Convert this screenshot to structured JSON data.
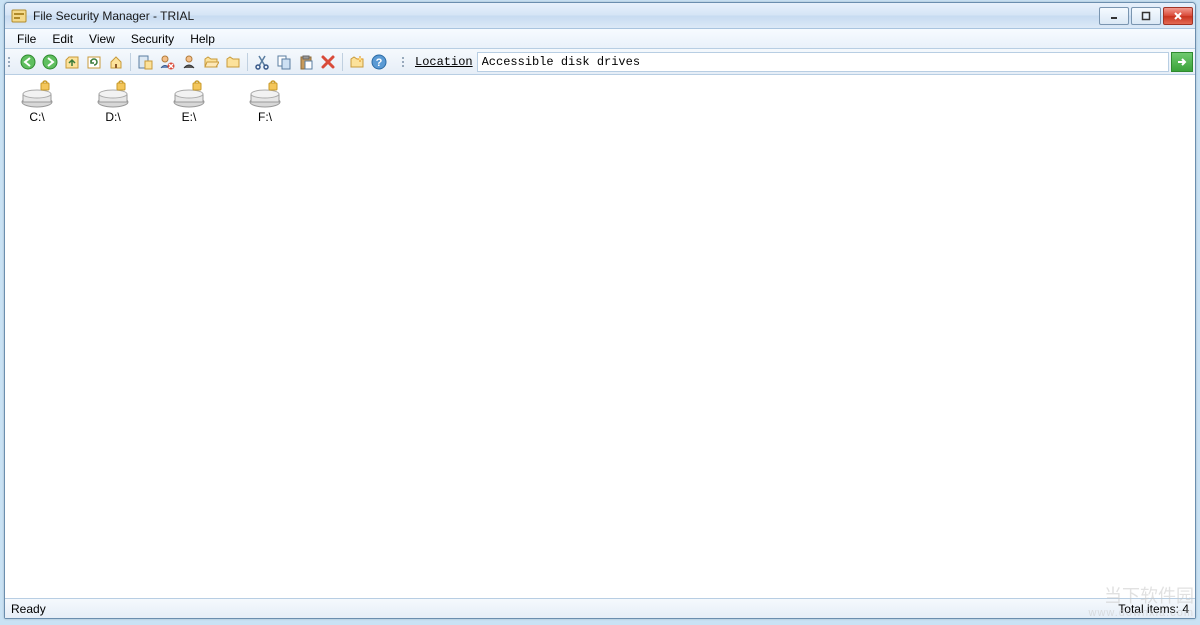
{
  "title": "File Security Manager - TRIAL",
  "menu": {
    "file": "File",
    "edit": "Edit",
    "view": "View",
    "security": "Security",
    "help": "Help"
  },
  "toolbar": {
    "icons": {
      "back": "back-icon",
      "forward": "forward-icon",
      "up": "up-icon",
      "refresh": "refresh-icon",
      "home": "home-icon",
      "perms": "permissions-icon",
      "deny": "deny-user-icon",
      "user": "user-icon",
      "folder_open": "folder-open-icon",
      "folder": "folder-icon",
      "cut": "cut-icon",
      "copy": "copy-icon",
      "paste": "paste-icon",
      "delete": "delete-icon",
      "new_folder": "new-folder-icon",
      "help": "help-icon"
    },
    "location_label": "Location",
    "location_value": "Accessible disk drives"
  },
  "drives": [
    {
      "label": "C:\\"
    },
    {
      "label": "D:\\"
    },
    {
      "label": "E:\\"
    },
    {
      "label": "F:\\"
    }
  ],
  "status": {
    "ready": "Ready",
    "total": "Total items: 4"
  },
  "watermark": {
    "line1": "当下软件园",
    "line2": "www.downxia.com"
  }
}
